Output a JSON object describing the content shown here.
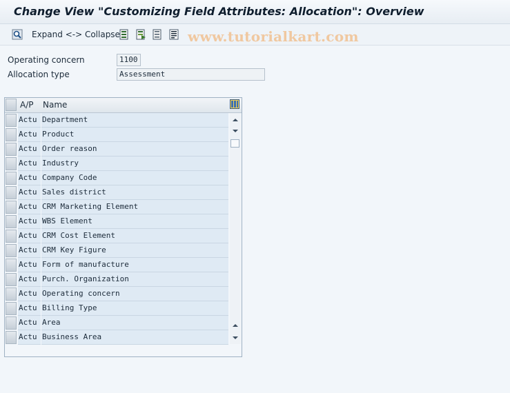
{
  "window": {
    "title": "Change View \"Customizing Field Attributes: Allocation\": Overview"
  },
  "toolbar": {
    "expand_collapse_label": "Expand <-> Collapse",
    "icons": [
      "find-icon",
      "select-all-icon",
      "select-block-icon",
      "deselect-all-icon",
      "details-icon"
    ]
  },
  "watermark": "www.tutorialkart.com",
  "fields": {
    "operating_concern": {
      "label": "Operating concern",
      "value": "1100"
    },
    "allocation_type": {
      "label": "Allocation type",
      "value": "Assessment"
    }
  },
  "table": {
    "columns": [
      "A/P",
      "Name"
    ],
    "rows": [
      {
        "ap": "Actu",
        "name": "Department"
      },
      {
        "ap": "Actu",
        "name": "Product"
      },
      {
        "ap": "Actu",
        "name": "Order reason"
      },
      {
        "ap": "Actu",
        "name": "Industry"
      },
      {
        "ap": "Actu",
        "name": "Company Code"
      },
      {
        "ap": "Actu",
        "name": "Sales district"
      },
      {
        "ap": "Actu",
        "name": "CRM Marketing Element"
      },
      {
        "ap": "Actu",
        "name": "WBS Element"
      },
      {
        "ap": "Actu",
        "name": "CRM Cost Element"
      },
      {
        "ap": "Actu",
        "name": "CRM Key Figure"
      },
      {
        "ap": "Actu",
        "name": "Form of manufacture"
      },
      {
        "ap": "Actu",
        "name": "Purch. Organization"
      },
      {
        "ap": "Actu",
        "name": "Operating concern"
      },
      {
        "ap": "Actu",
        "name": "Billing Type"
      },
      {
        "ap": "Actu",
        "name": "Area"
      },
      {
        "ap": "Actu",
        "name": "Business Area"
      }
    ]
  },
  "colors": {
    "row_bg": "#dfeaf4",
    "background": "#f2f6fa",
    "watermark": "#f0c8a0"
  }
}
